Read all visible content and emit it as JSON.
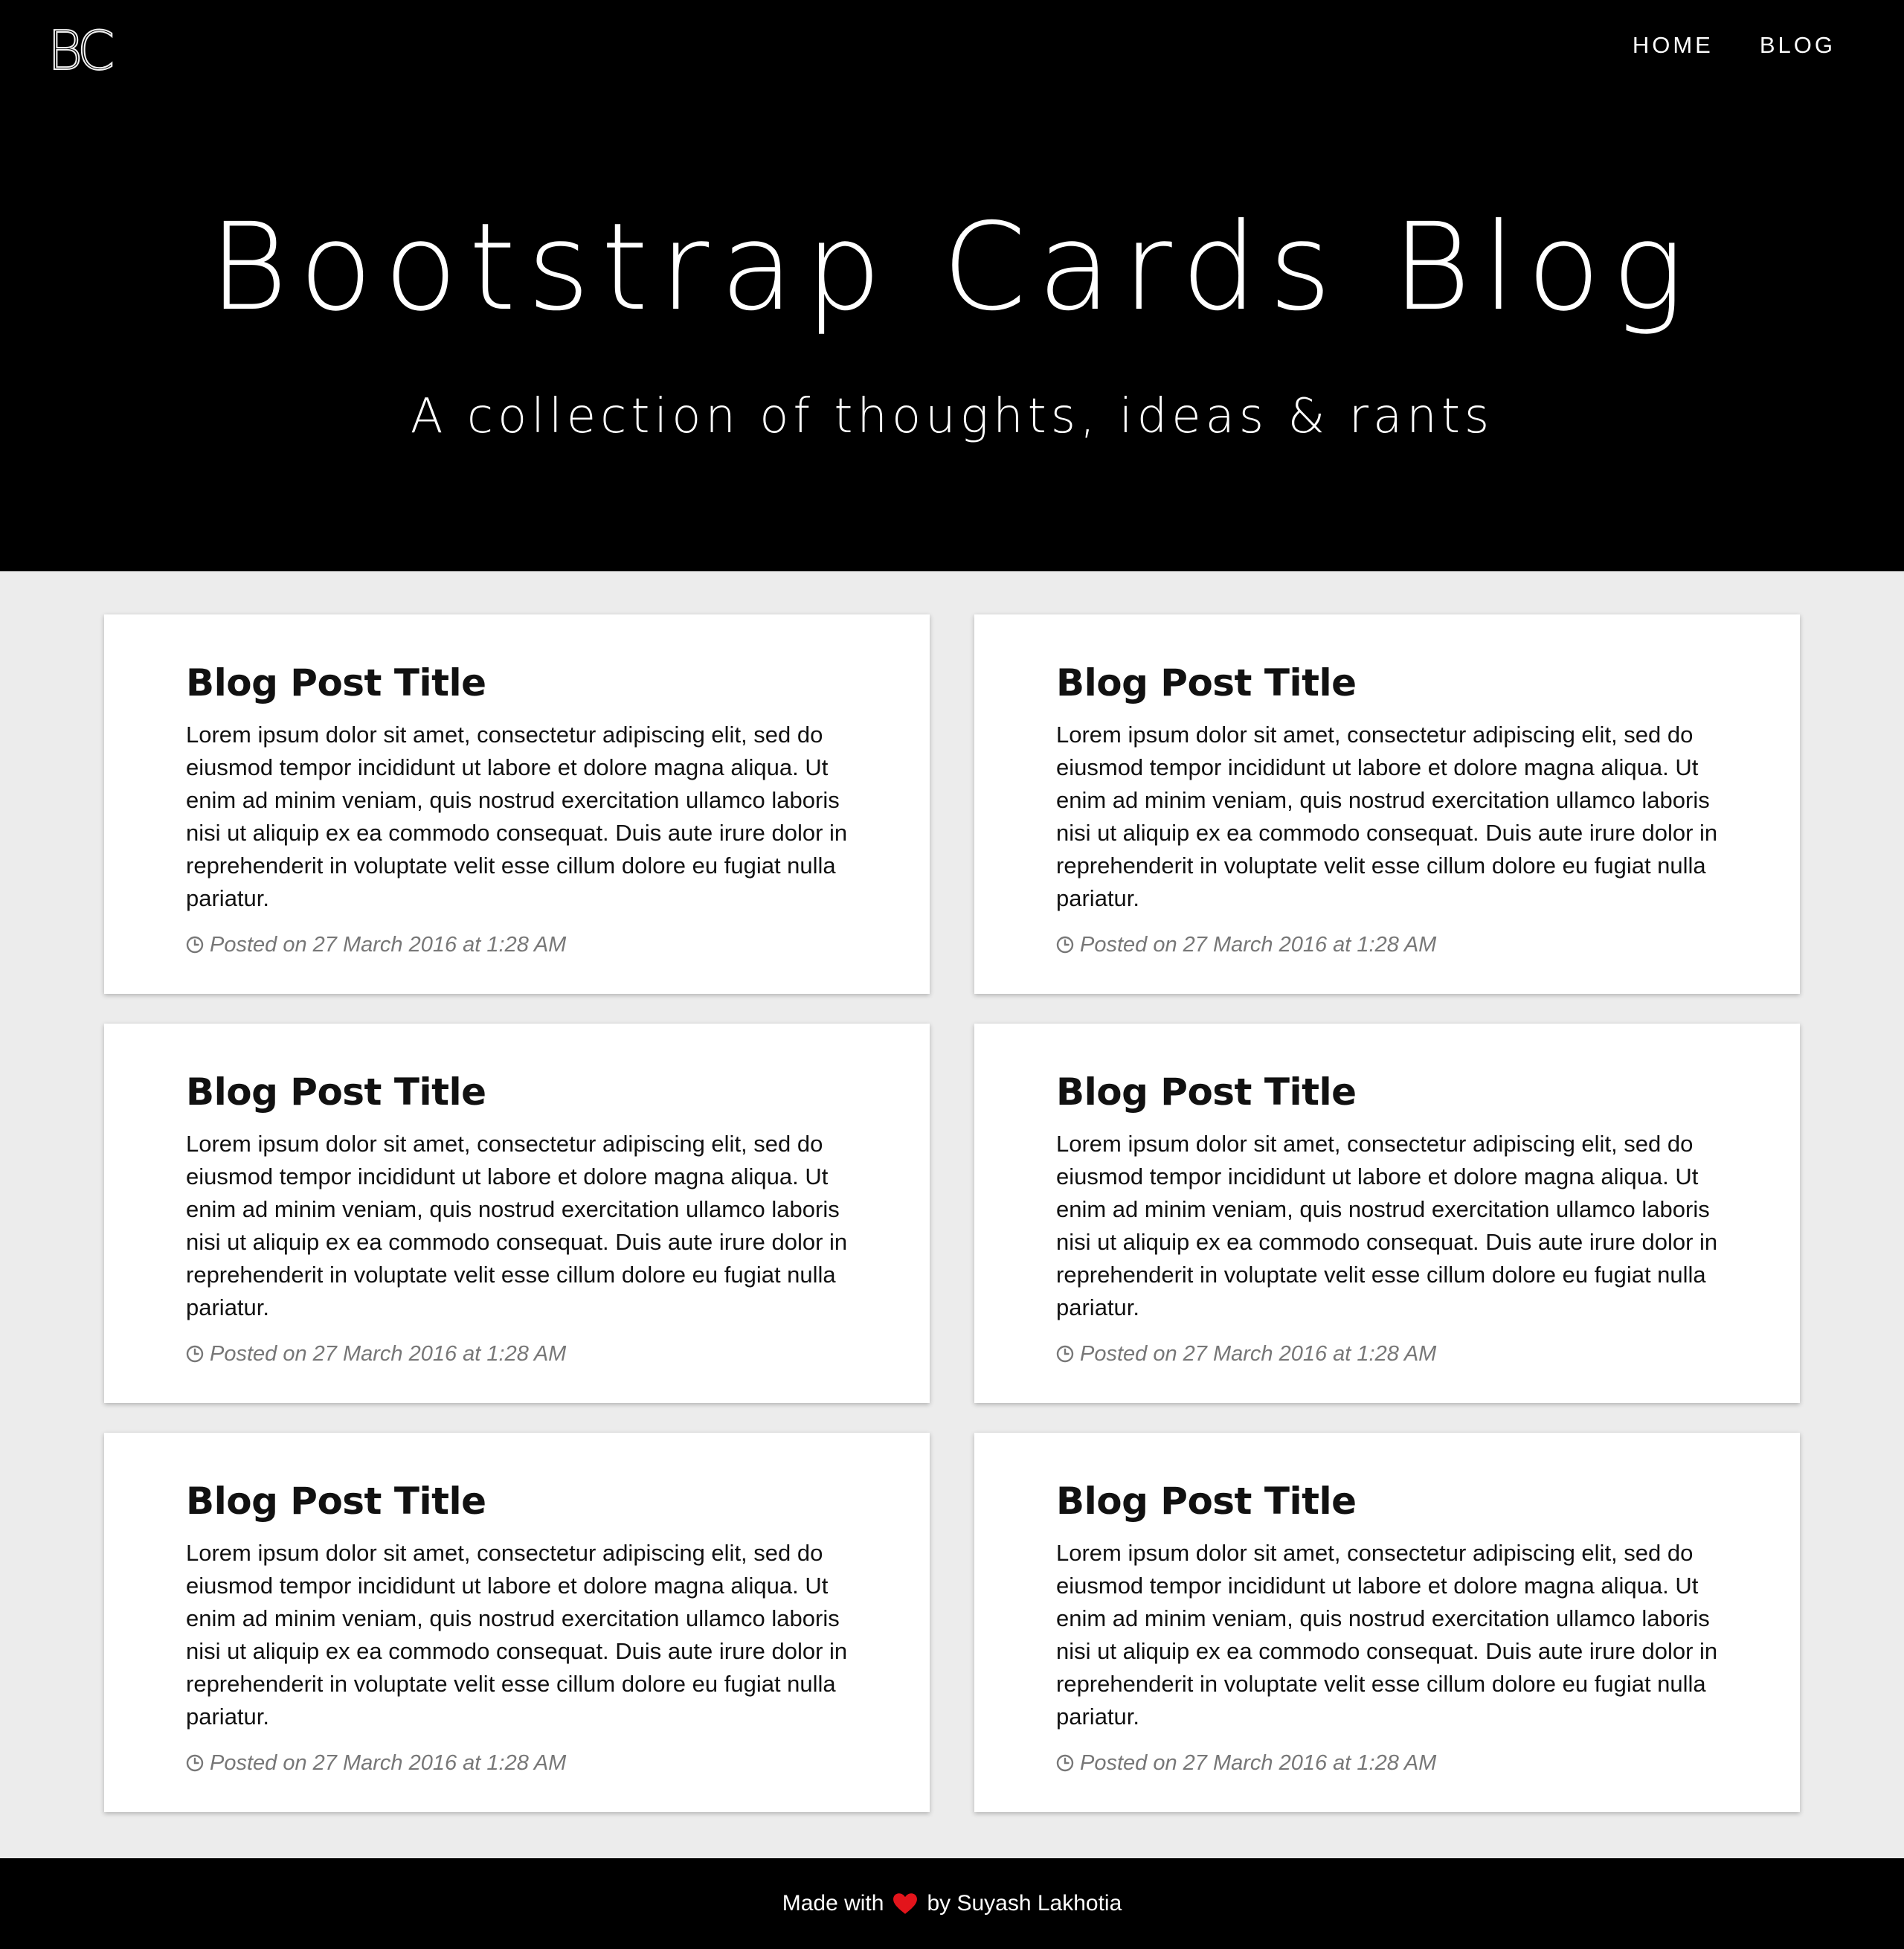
{
  "header": {
    "logo_text": "BC",
    "nav": {
      "home_label": "HOME",
      "blog_label": "BLOG"
    }
  },
  "hero": {
    "title": "Bootstrap Cards Blog",
    "subtitle": "A collection of thoughts, ideas & rants"
  },
  "posts": [
    {
      "title": "Blog Post Title",
      "body": "Lorem ipsum dolor sit amet, consectetur adipiscing elit, sed do eiusmod tempor incididunt ut labore et dolore magna aliqua. Ut enim ad minim veniam, quis nostrud exercitation ullamco laboris nisi ut aliquip ex ea commodo consequat. Duis aute irure dolor in reprehenderit in voluptate velit esse cillum dolore eu fugiat nulla pariatur.",
      "meta": "Posted on 27 March 2016 at 1:28 AM",
      "meta_icon": "clock-icon"
    },
    {
      "title": "Blog Post Title",
      "body": "Lorem ipsum dolor sit amet, consectetur adipiscing elit, sed do eiusmod tempor incididunt ut labore et dolore magna aliqua. Ut enim ad minim veniam, quis nostrud exercitation ullamco laboris nisi ut aliquip ex ea commodo consequat. Duis aute irure dolor in reprehenderit in voluptate velit esse cillum dolore eu fugiat nulla pariatur.",
      "meta": "Posted on 27 March 2016 at 1:28 AM",
      "meta_icon": "clock-icon"
    },
    {
      "title": "Blog Post Title",
      "body": "Lorem ipsum dolor sit amet, consectetur adipiscing elit, sed do eiusmod tempor incididunt ut labore et dolore magna aliqua. Ut enim ad minim veniam, quis nostrud exercitation ullamco laboris nisi ut aliquip ex ea commodo consequat. Duis aute irure dolor in reprehenderit in voluptate velit esse cillum dolore eu fugiat nulla pariatur.",
      "meta": "Posted on 27 March 2016 at 1:28 AM",
      "meta_icon": "clock-icon"
    },
    {
      "title": "Blog Post Title",
      "body": "Lorem ipsum dolor sit amet, consectetur adipiscing elit, sed do eiusmod tempor incididunt ut labore et dolore magna aliqua. Ut enim ad minim veniam, quis nostrud exercitation ullamco laboris nisi ut aliquip ex ea commodo consequat. Duis aute irure dolor in reprehenderit in voluptate velit esse cillum dolore eu fugiat nulla pariatur.",
      "meta": "Posted on 27 March 2016 at 1:28 AM",
      "meta_icon": "clock-icon"
    },
    {
      "title": "Blog Post Title",
      "body": "Lorem ipsum dolor sit amet, consectetur adipiscing elit, sed do eiusmod tempor incididunt ut labore et dolore magna aliqua. Ut enim ad minim veniam, quis nostrud exercitation ullamco laboris nisi ut aliquip ex ea commodo consequat. Duis aute irure dolor in reprehenderit in voluptate velit esse cillum dolore eu fugiat nulla pariatur.",
      "meta": "Posted on 27 March 2016 at 1:28 AM",
      "meta_icon": "clock-icon"
    },
    {
      "title": "Blog Post Title",
      "body": "Lorem ipsum dolor sit amet, consectetur adipiscing elit, sed do eiusmod tempor incididunt ut labore et dolore magna aliqua. Ut enim ad minim veniam, quis nostrud exercitation ullamco laboris nisi ut aliquip ex ea commodo consequat. Duis aute irure dolor in reprehenderit in voluptate velit esse cillum dolore eu fugiat nulla pariatur.",
      "meta": "Posted on 27 March 2016 at 1:28 AM",
      "meta_icon": "clock-icon"
    }
  ],
  "footer": {
    "made_with": "Made with",
    "by_text": "by Suyash Lakhotia",
    "heart_icon": "heart-icon",
    "heart_color": "#e3141b"
  },
  "colors": {
    "header_bg": "#000000",
    "page_bg": "#ececec",
    "card_bg": "#ffffff",
    "meta_text": "#777777"
  }
}
